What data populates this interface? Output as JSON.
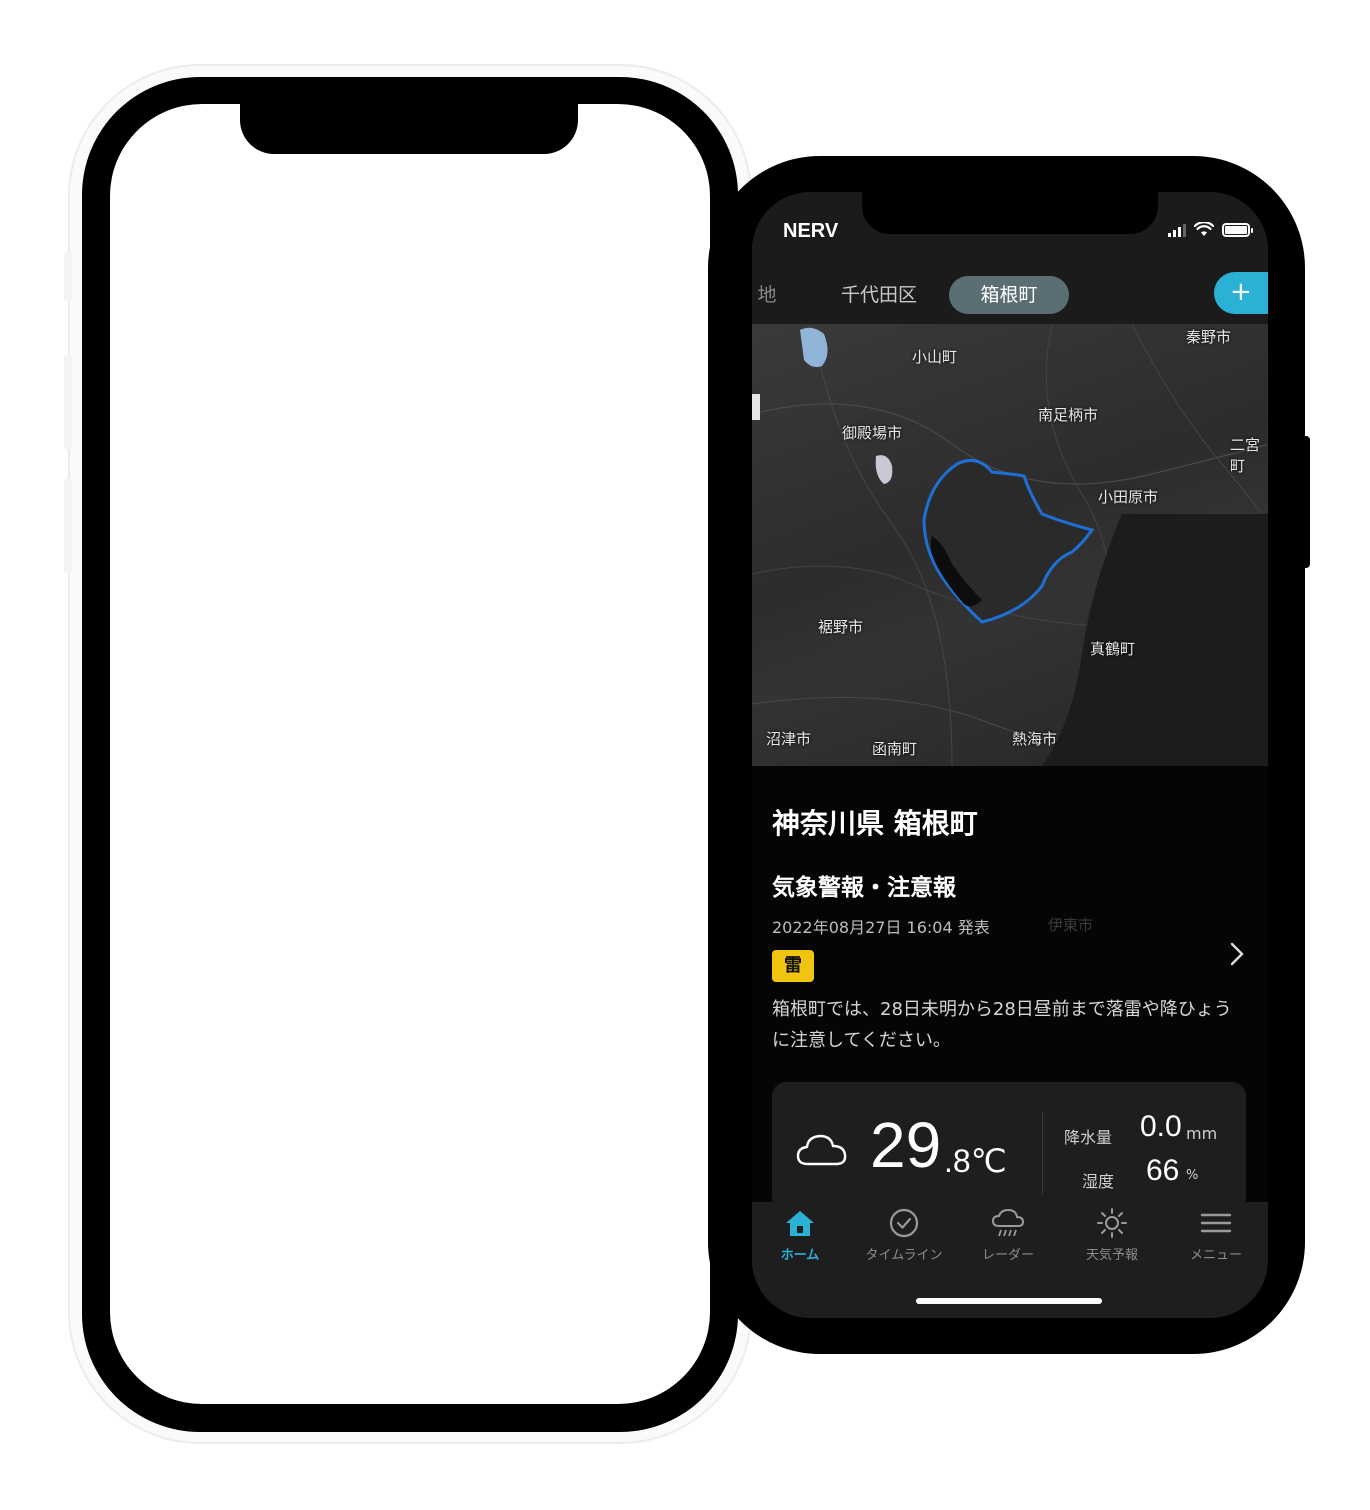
{
  "status_bar": {
    "app_name": "NERV"
  },
  "tabs": {
    "partial": "地",
    "items": [
      "千代田区",
      "箱根町"
    ],
    "add": "+"
  },
  "map": {
    "labels": {
      "oyama": "小山町",
      "hadano": "秦野市",
      "minamiashigara": "南足柄市",
      "gotemba": "御殿場市",
      "ninomiya": "二宮町",
      "odawara": "小田原市",
      "susono": "裾野市",
      "manazuru": "真鶴町",
      "numazu": "沼津市",
      "kannami": "函南町",
      "atami": "熱海市"
    }
  },
  "content": {
    "area_title": "神奈川県 箱根町",
    "warning_title": "気象警報・注意報",
    "issued": "2022年08月27日 16:04 発表",
    "ghost_label": "伊東市",
    "badge": "雷",
    "warning_text": "箱根町では、28日未明から28日昼前まで落雷や降ひょうに注意してください。"
  },
  "weather": {
    "icon": "cloud-icon",
    "temp_int": "29",
    "temp_dec": ".8℃",
    "precip_label": "降水量",
    "precip_value": "0.0",
    "precip_unit": "mm",
    "humidity_label": "湿度",
    "humidity_value": "66",
    "humidity_unit": "%"
  },
  "nav": {
    "items": [
      {
        "label": "ホーム",
        "icon": "home-icon",
        "active": true
      },
      {
        "label": "タイムライン",
        "icon": "check-circle-icon",
        "active": false
      },
      {
        "label": "レーダー",
        "icon": "rain-cloud-icon",
        "active": false
      },
      {
        "label": "天気予報",
        "icon": "sun-icon",
        "active": false
      },
      {
        "label": "メニュー",
        "icon": "menu-icon",
        "active": false
      }
    ]
  },
  "colors": {
    "accent": "#2bb1d6",
    "badge": "#f1c40f",
    "boundary": "#1e6fd6"
  }
}
